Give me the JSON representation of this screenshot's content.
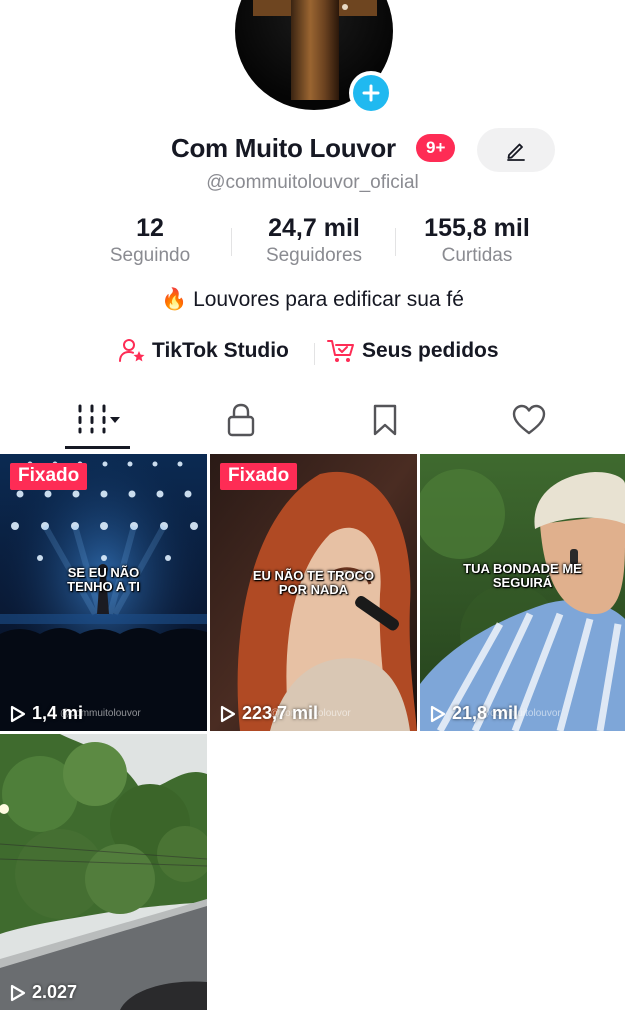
{
  "profile": {
    "name": "Com Muito Louvor",
    "notification_badge": "9+",
    "handle": "@commuitolouvor_oficial",
    "bio": "🔥 Louvores para edificar sua fé"
  },
  "stats": [
    {
      "value": "12",
      "label": "Seguindo"
    },
    {
      "value": "24,7 mil",
      "label": "Seguidores"
    },
    {
      "value": "155,8 mil",
      "label": "Curtidas"
    }
  ],
  "links": {
    "studio": "TikTok Studio",
    "orders": "Seus pedidos"
  },
  "videos": [
    {
      "pinned": "Fixado",
      "overlay": "SE EU NÃO TENHO A TI",
      "views": "1,4 mi",
      "watermark": "@commuitolouvor"
    },
    {
      "pinned": "Fixado",
      "overlay": "EU NÃO TE TROCO POR NADA",
      "views": "223,7 mil",
      "watermark": "@commuitolouvor"
    },
    {
      "overlay": "TUA BONDADE ME SEGUIRÁ",
      "views": "21,8 mil",
      "watermark": "@commuitolouvor"
    },
    {
      "views": "2.027"
    }
  ],
  "colors": {
    "accent": "#fe2c55",
    "add_badge": "#20b9f0",
    "text_primary": "#161823",
    "text_secondary": "#8a8b91"
  }
}
